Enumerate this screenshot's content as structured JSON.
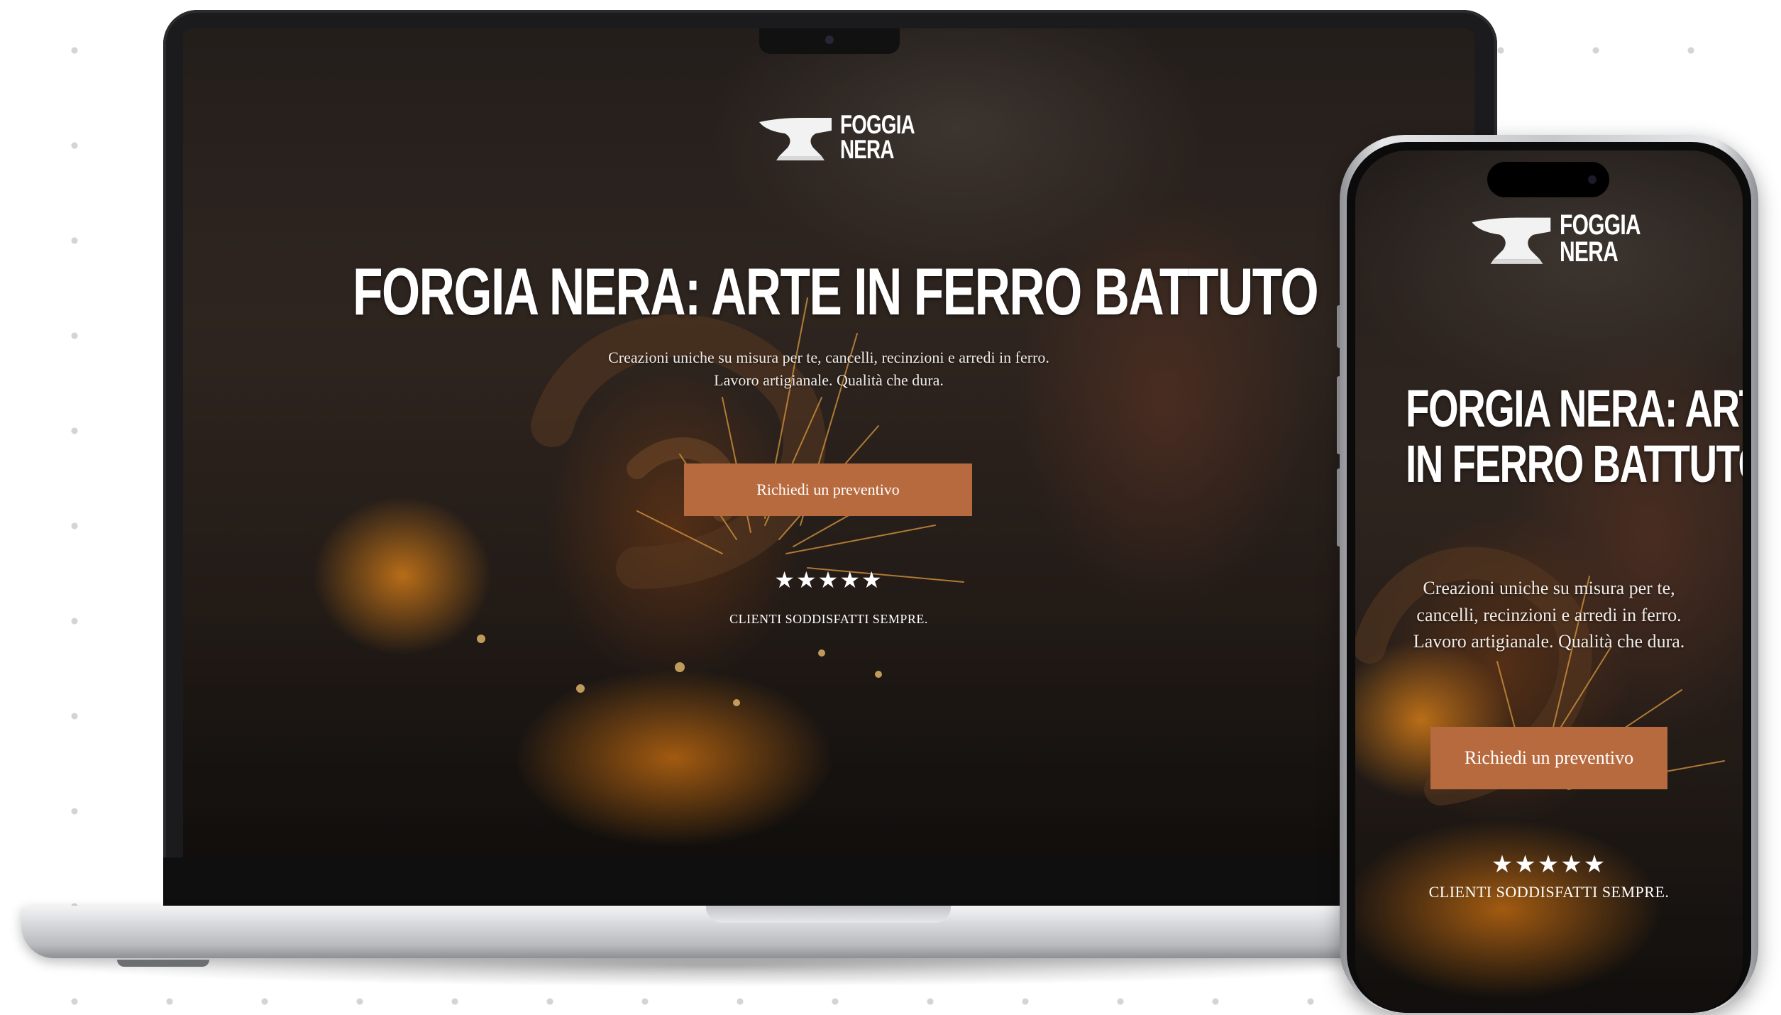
{
  "site": {
    "logo": {
      "line1": "FOGGIA",
      "line2": "NERA",
      "icon": "anvil-icon"
    },
    "hero": {
      "title": "FORGIA NERA: ARTE IN FERRO BATTUTO",
      "title_mobile_line1": "FORGIA NERA: ARTE",
      "title_mobile_line2": "IN FERRO BATTUTO",
      "subtitle_line1": "Creazioni uniche su misura per te, cancelli, recinzioni e arredi in ferro.",
      "subtitle_line2": "Lavoro artigianale. Qualità che dura.",
      "subtitle_mobile_line1": "Creazioni uniche su misura per te,",
      "subtitle_mobile_line2": "cancelli, recinzioni e arredi in ferro.",
      "subtitle_mobile_line3": "Lavoro artigianale. Qualità che dura.",
      "cta_label": "Richiedi un preventivo",
      "stars": "★★★★★",
      "rating_value": 5,
      "rating_text": "CLIENTI SODDISFATTI SEMPRE."
    }
  },
  "colors": {
    "cta_background": "#b86a3f",
    "page_background": "#ffffff",
    "text": "#ffffff"
  }
}
